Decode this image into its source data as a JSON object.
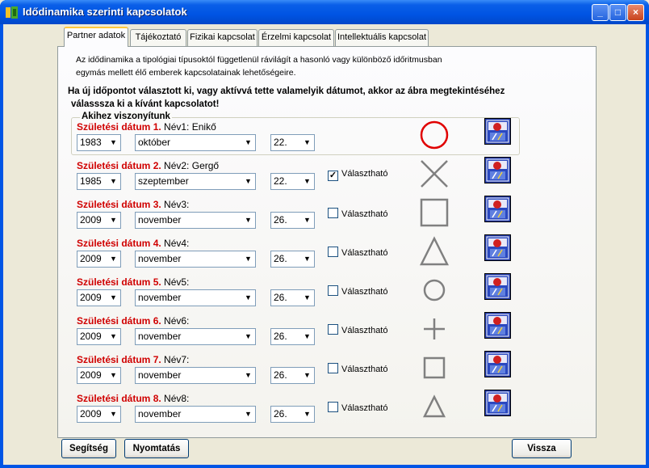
{
  "window": {
    "title": "Idődinamika szerinti kapcsolatok",
    "minimize": "_",
    "maximize": "□",
    "close": "×"
  },
  "tabs": [
    {
      "label": "Partner adatok",
      "active": true
    },
    {
      "label": "Tájékoztató",
      "active": false
    },
    {
      "label": "Fizikai kapcsolat",
      "active": false
    },
    {
      "label": "Érzelmi kapcsolat",
      "active": false
    },
    {
      "label": "Intellektuális kapcsolat",
      "active": false
    }
  ],
  "intro": {
    "line1": "Az idődinamika a tipológiai típusoktól függetlenül rávilágít a hasonló vagy különböző időritmusban",
    "line2": "egymás mellett élő emberek kapcsolatainak lehetőségeire.",
    "bold1": "Ha új időpontot választott ki, vagy aktívvá tette valamelyik dátumot, akkor az ábra megtekintéséhez",
    "bold2": "válasssza ki a kívánt kapcsolatot!"
  },
  "group_label": "Akihez viszonyítunk",
  "rows": [
    {
      "label": "Születési dátum 1.",
      "name": "Név1: Enikő",
      "year": "1983",
      "month": "október",
      "day": "22.",
      "checkbox": "",
      "checked": false,
      "shape": "circle-red"
    },
    {
      "label": "Születési dátum 2.",
      "name": "Név2: Gergő",
      "year": "1985",
      "month": "szeptember",
      "day": "22.",
      "checkbox": "Választható",
      "checked": true,
      "shape": "x-cross"
    },
    {
      "label": "Születési dátum 3.",
      "name": "Név3:",
      "year": "2009",
      "month": "november",
      "day": "26.",
      "checkbox": "Választható",
      "checked": false,
      "shape": "square"
    },
    {
      "label": "Születési dátum 4.",
      "name": "Név4:",
      "year": "2009",
      "month": "november",
      "day": "26.",
      "checkbox": "Választható",
      "checked": false,
      "shape": "triangle"
    },
    {
      "label": "Születési dátum 5.",
      "name": "Név5:",
      "year": "2009",
      "month": "november",
      "day": "26.",
      "checkbox": "Választható",
      "checked": false,
      "shape": "circle-small"
    },
    {
      "label": "Születési dátum 6.",
      "name": "Név6:",
      "year": "2009",
      "month": "november",
      "day": "26.",
      "checkbox": "Választható",
      "checked": false,
      "shape": "plus"
    },
    {
      "label": "Születési dátum 7.",
      "name": "Név7:",
      "year": "2009",
      "month": "november",
      "day": "26.",
      "checkbox": "Választható",
      "checked": false,
      "shape": "square-small"
    },
    {
      "label": "Születési dátum 8.",
      "name": "Név8:",
      "year": "2009",
      "month": "november",
      "day": "26.",
      "checkbox": "Választható",
      "checked": false,
      "shape": "triangle-small"
    }
  ],
  "buttons": {
    "help": "Segítség",
    "print": "Nyomtatás",
    "back": "Vissza"
  },
  "colors": {
    "titlebar": "#0054e3",
    "label_red": "#d00000",
    "shape_red": "#e00000",
    "shape_grey": "#808080"
  }
}
